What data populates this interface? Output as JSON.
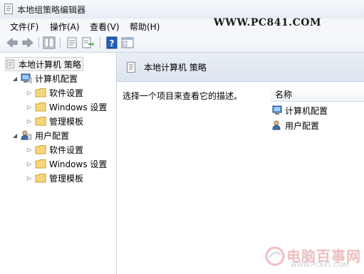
{
  "window": {
    "title": "本地组策略编辑器"
  },
  "menu": {
    "items": [
      "文件(F)",
      "操作(A)",
      "查看(V)",
      "帮助(H)"
    ]
  },
  "watermark": {
    "top_text": "WWW.PC841.COM",
    "bottom_cn": "电脑百事网",
    "bottom_url": "WWW.PC841.COM"
  },
  "tree": {
    "root": "本地计算机 策略",
    "computer": {
      "label": "计算机配置",
      "children": [
        "软件设置",
        "Windows 设置",
        "管理模板"
      ]
    },
    "user": {
      "label": "用户配置",
      "children": [
        "软件设置",
        "Windows 设置",
        "管理模板"
      ]
    }
  },
  "right": {
    "header_title": "本地计算机 策略",
    "description": "选择一个项目来查看它的描述。",
    "column_name": "名称",
    "items": [
      "计算机配置",
      "用户配置"
    ]
  }
}
